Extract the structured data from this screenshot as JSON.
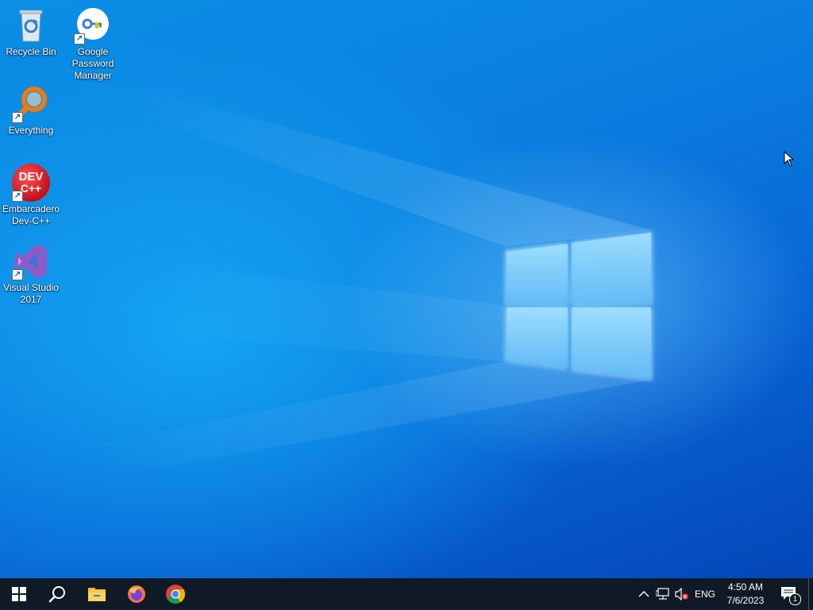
{
  "desktop": {
    "icons": [
      {
        "label": "Recycle Bin",
        "icon": "recycle-bin-icon"
      },
      {
        "label": "Google Password Manager",
        "icon": "google-password-manager-icon"
      },
      {
        "label": "Everything",
        "icon": "everything-search-icon"
      },
      {
        "label": "Embarcadero Dev-C++",
        "icon": "dev-cpp-icon"
      },
      {
        "label": "Visual Studio 2017",
        "icon": "visual-studio-icon"
      }
    ]
  },
  "devcpp_logo": {
    "line1": "DEV",
    "line2": "C++"
  },
  "taskbar": {
    "apps": [
      {
        "name": "Start",
        "icon": "windows-start-icon"
      },
      {
        "name": "Search",
        "icon": "search-icon"
      },
      {
        "name": "File Explorer",
        "icon": "file-explorer-icon"
      },
      {
        "name": "Firefox",
        "icon": "firefox-icon"
      },
      {
        "name": "Chrome",
        "icon": "chrome-icon"
      }
    ],
    "tray": {
      "language": "ENG",
      "time": "4:50 AM",
      "date": "7/6/2023",
      "notification_count": "1"
    }
  },
  "colors": {
    "taskbar": "#0f1a26",
    "desktop_accent": "#0b7fe0"
  }
}
